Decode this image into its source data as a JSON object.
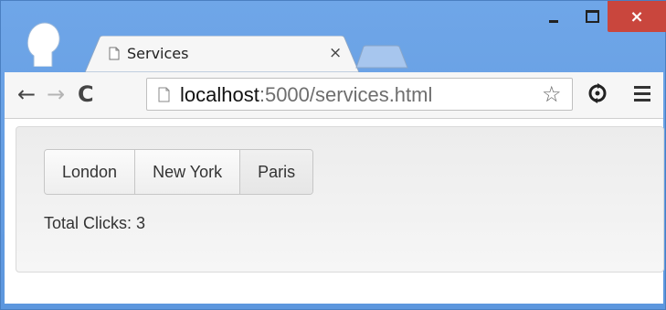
{
  "window": {
    "controls": {
      "minimize_icon": "minimize-icon",
      "maximize_icon": "maximize-icon",
      "close_label": "×"
    }
  },
  "tab": {
    "title": "Services",
    "close_label": "×"
  },
  "toolbar": {
    "back_label": "←",
    "forward_label": "→",
    "reload_label": "C",
    "url_host": "localhost",
    "url_rest": ":5000/services.html",
    "star_label": "☆"
  },
  "page": {
    "buttons": [
      {
        "label": "London"
      },
      {
        "label": "New York"
      },
      {
        "label": "Paris"
      }
    ],
    "total_text": "Total Clicks: 3"
  },
  "colors": {
    "frame": "#6fa6e8",
    "close_button": "#c9463d",
    "toolbar": "#f6f6f6"
  }
}
